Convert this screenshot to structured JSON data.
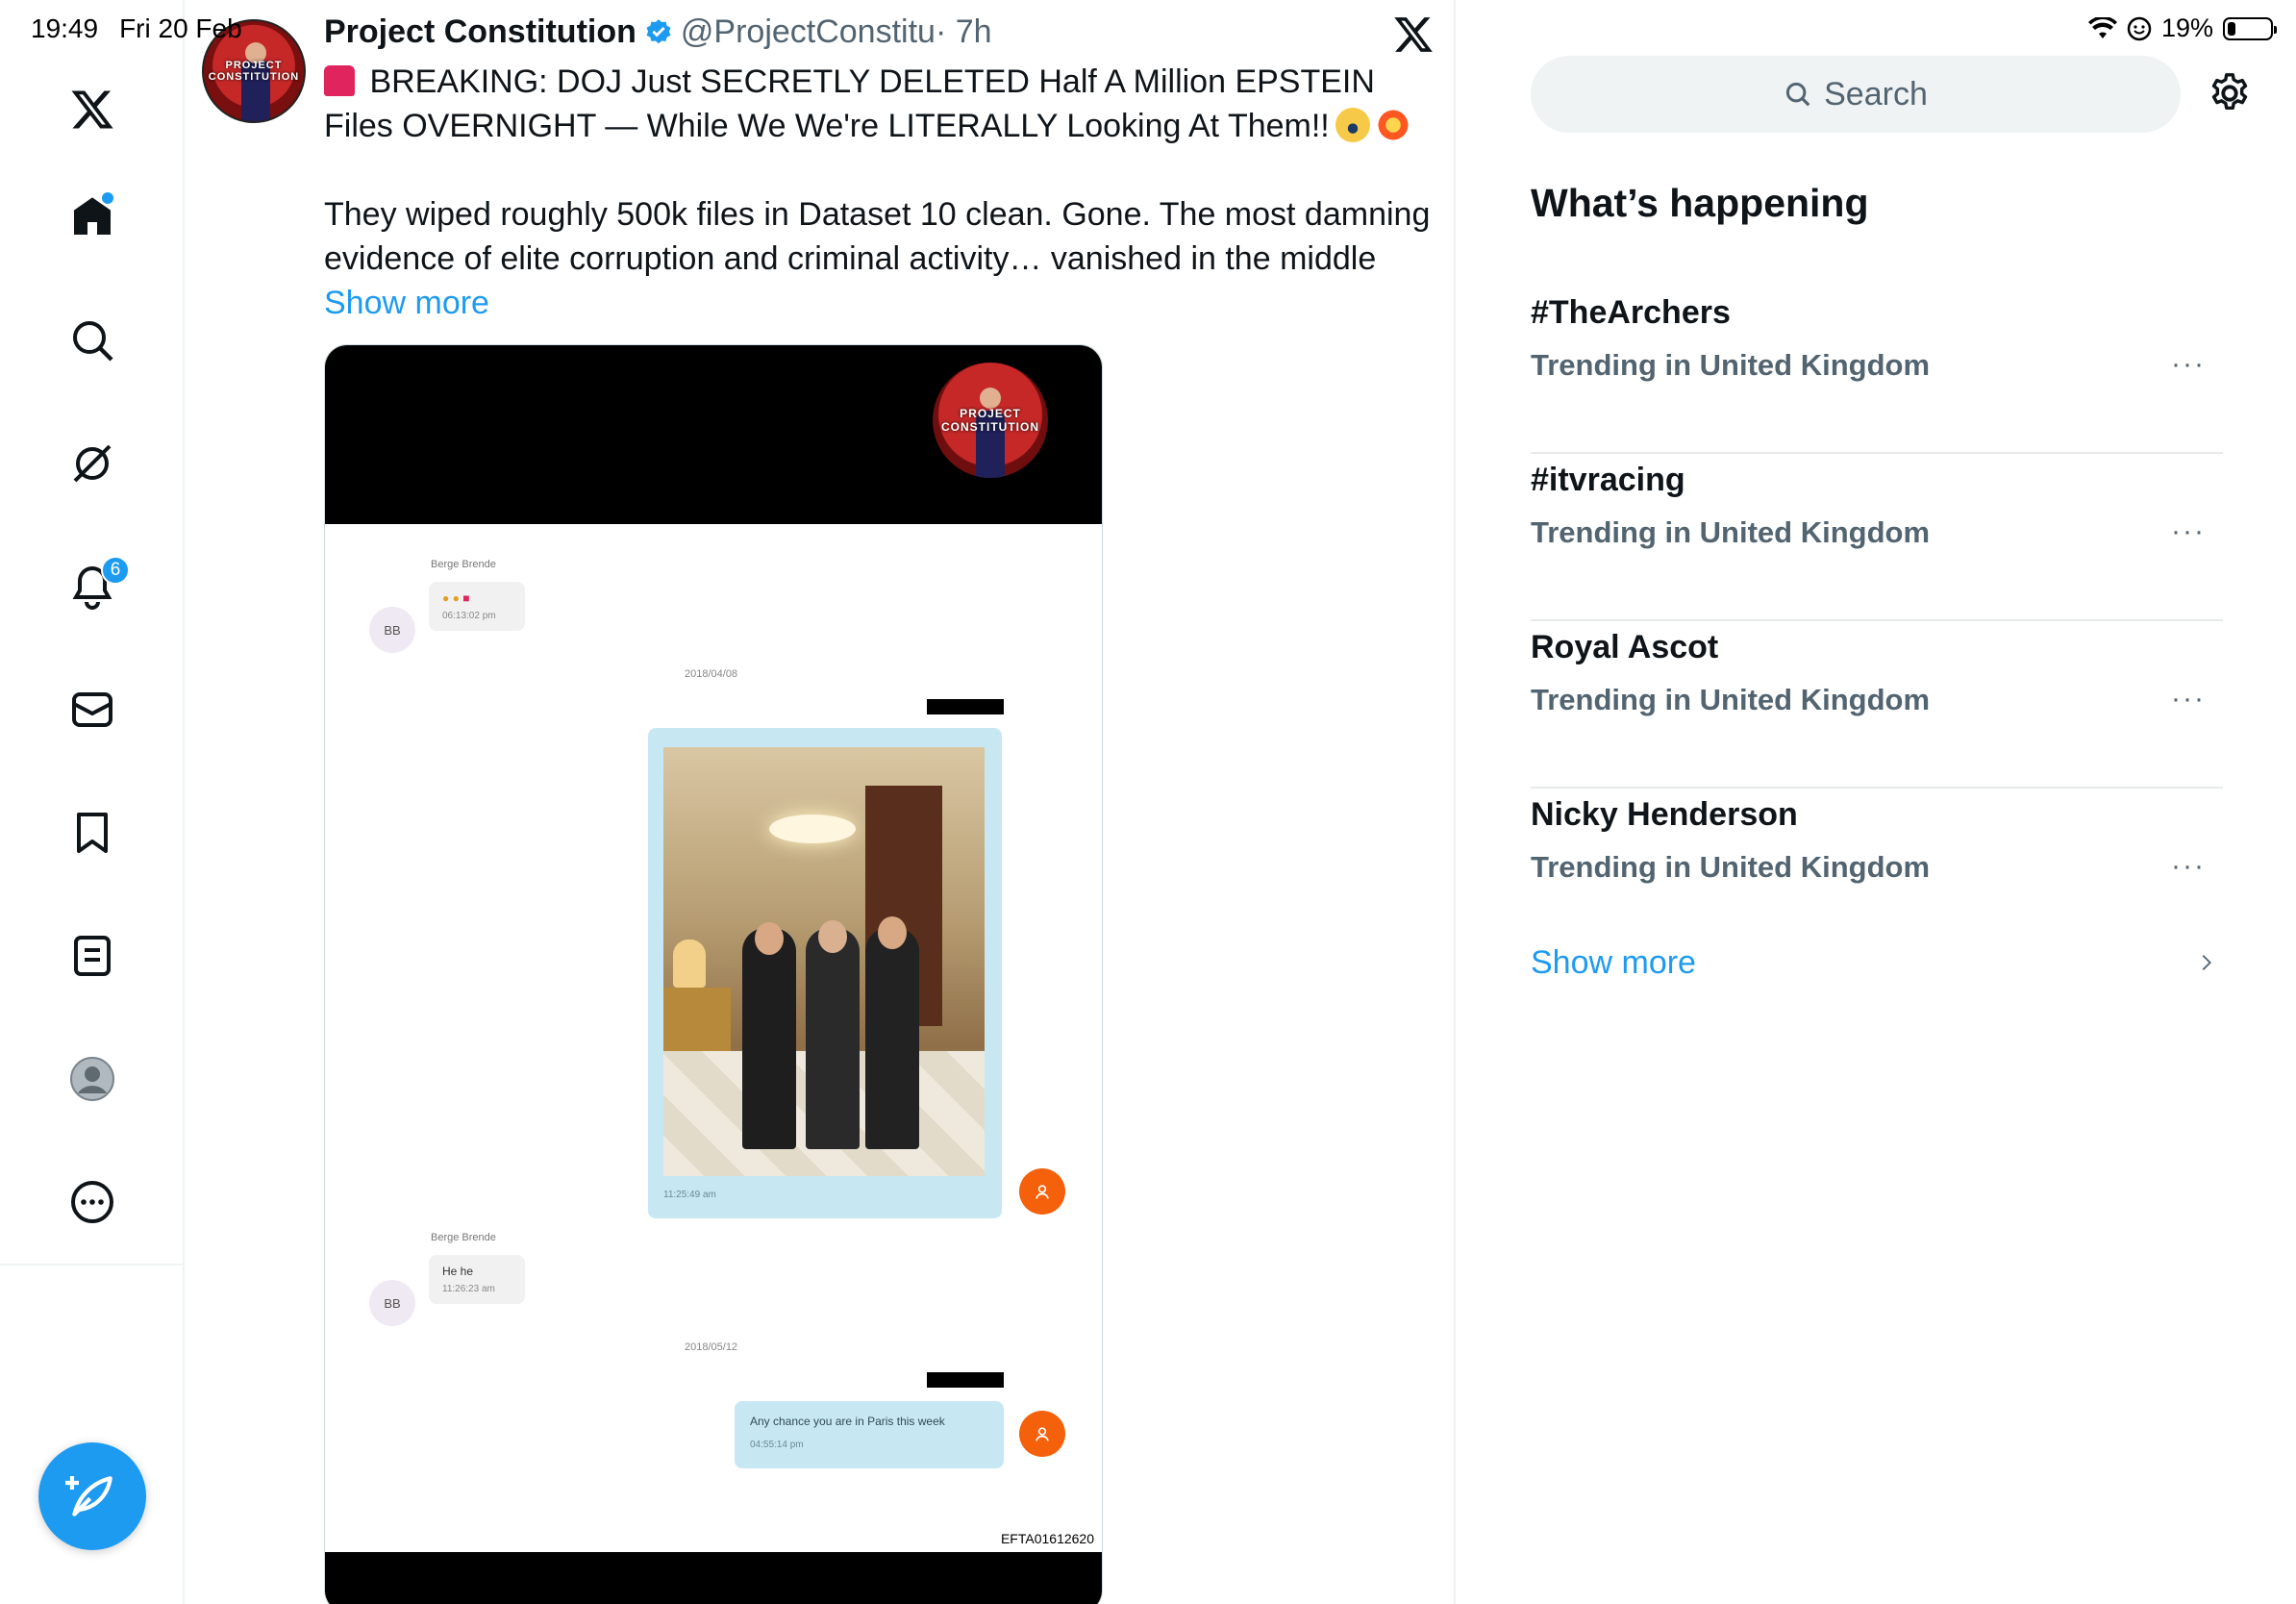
{
  "status_bar": {
    "time": "19:49",
    "date": "Fri 20 Feb",
    "battery": "19%",
    "battery_level": 0.19
  },
  "nav": {
    "items": [
      {
        "name": "x-logo-icon"
      },
      {
        "name": "home-icon",
        "has_dot": true
      },
      {
        "name": "search-icon"
      },
      {
        "name": "grok-icon"
      },
      {
        "name": "notifications-icon",
        "badge": "6"
      },
      {
        "name": "messages-icon"
      },
      {
        "name": "bookmarks-icon"
      },
      {
        "name": "lists-icon"
      },
      {
        "name": "profile-icon"
      },
      {
        "name": "more-icon"
      }
    ],
    "compose": "compose-icon"
  },
  "tweet": {
    "author": "Project Constitution",
    "handle": "@ProjectConstitu",
    "time": "· 7h",
    "line1": " BREAKING: DOJ Just SECRETLY DELETED Half A Million EPSTEIN Files OVERNIGHT — While We We're LITERALLY Looking At Them!!",
    "para2": "They wiped roughly 500k files in Dataset 10 clean. Gone. The most damning evidence of elite corruption and criminal activity… vanished in the middle",
    "show_more": "Show more",
    "avatar_text": "PROJECT CONSTITUTION"
  },
  "media": {
    "sender1": "Berge Brende",
    "bb": "BB",
    "msg1_time": "06:13:02 pm",
    "date1": "2018/04/08",
    "photo_time": "11:25:49 am",
    "sender2": "Berge Brende",
    "msg2_text": "He he",
    "msg2_time": "11:26:23 am",
    "date2": "2018/05/12",
    "out_text": "Any chance you are in Paris this week",
    "out_time": "04:55:14 pm",
    "code": "EFTA01612620"
  },
  "right": {
    "search_placeholder": "Search",
    "heading": "What’s happening",
    "trends": [
      {
        "name": "#TheArchers",
        "sub": "Trending in United Kingdom"
      },
      {
        "name": "#itvracing",
        "sub": "Trending in United Kingdom"
      },
      {
        "name": "Royal Ascot",
        "sub": "Trending in United Kingdom"
      },
      {
        "name": "Nicky Henderson",
        "sub": "Trending in United Kingdom"
      }
    ],
    "show_more": "Show more"
  },
  "colors": {
    "accent": "#1d9bf0",
    "text": "#0f1419",
    "muted": "#536471"
  }
}
